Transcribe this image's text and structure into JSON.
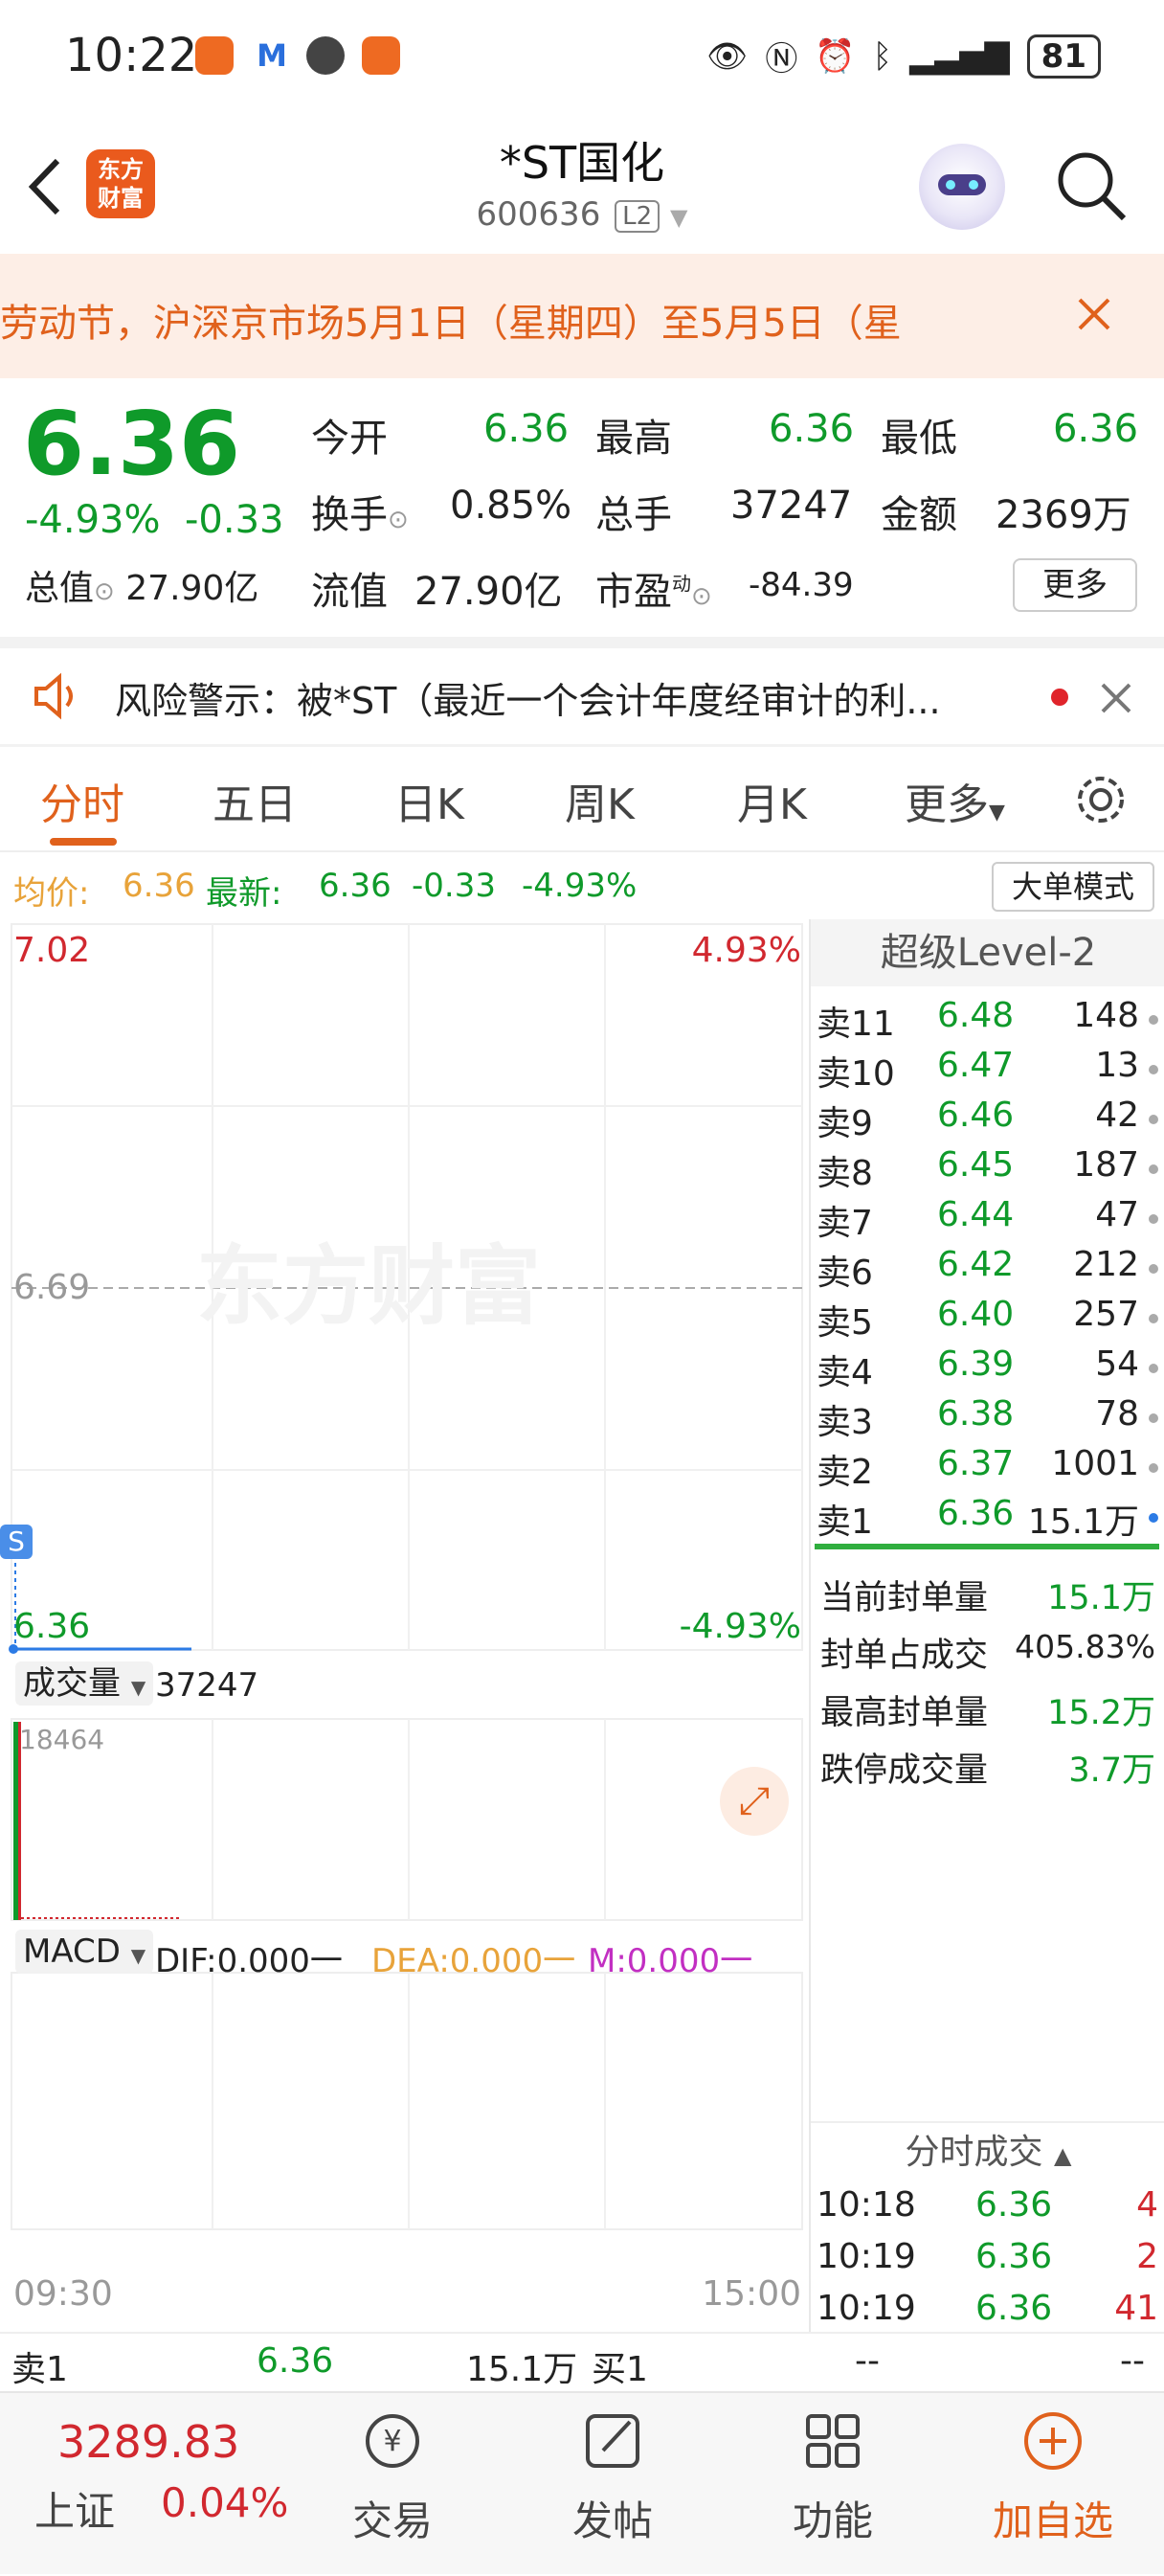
{
  "status_bar": {
    "time": "10:22",
    "battery": "81"
  },
  "header": {
    "title": "*ST国化",
    "code": "600636",
    "level_badge": "L2",
    "logo_text_1": "东方",
    "logo_text_2": "财富"
  },
  "banner": {
    "text": "劳动节，沪深京市场5月1日（星期四）至5月5日（星"
  },
  "quote": {
    "price": "6.36",
    "change_pct": "-4.93%",
    "change": "-0.33",
    "open_label": "今开",
    "open": "6.36",
    "high_label": "最高",
    "high": "6.36",
    "low_label": "最低",
    "low": "6.36",
    "turnover_label": "换手",
    "turnover": "0.85%",
    "volume_label": "总手",
    "volume": "37247",
    "amount_label": "金额",
    "amount": "2369万",
    "mktcap_label": "总值",
    "mktcap": "27.90亿",
    "float_label": "流值",
    "float": "27.90亿",
    "pe_label": "市盈",
    "pe_sup": "动",
    "pe": "-84.39",
    "more_label": "更多"
  },
  "risk": {
    "text": "风险警示：被*ST（最近一个会计年度经审计的利..."
  },
  "tabs": [
    "分时",
    "五日",
    "日K",
    "周K",
    "月K",
    "更多"
  ],
  "avg_line": {
    "avg_label": "均价:",
    "avg": "6.36",
    "latest_label": "最新:",
    "latest": "6.36",
    "change": "-0.33",
    "pct": "-4.93%",
    "big_order": "大单模式"
  },
  "chart": {
    "y_max": "7.02",
    "y_max_pct": "4.93%",
    "y_mid": "6.69",
    "y_min": "6.36",
    "y_min_pct": "-4.93%",
    "s_marker": "S",
    "watermark": "东方财富",
    "volume_label": "成交量",
    "volume_total": "37247",
    "volume_max": "18464",
    "macd_label": "MACD",
    "dif": "DIF:0.000一",
    "dea": "DEA:0.000一",
    "m": "M:0.000一",
    "time_start": "09:30",
    "time_end": "15:00"
  },
  "level2": {
    "title": "超级Level-2",
    "asks": [
      {
        "label": "卖11",
        "price": "6.48",
        "vol": "148"
      },
      {
        "label": "卖10",
        "price": "6.47",
        "vol": "13"
      },
      {
        "label": "卖9",
        "price": "6.46",
        "vol": "42"
      },
      {
        "label": "卖8",
        "price": "6.45",
        "vol": "187"
      },
      {
        "label": "卖7",
        "price": "6.44",
        "vol": "47"
      },
      {
        "label": "卖6",
        "price": "6.42",
        "vol": "212"
      },
      {
        "label": "卖5",
        "price": "6.40",
        "vol": "257"
      },
      {
        "label": "卖4",
        "price": "6.39",
        "vol": "54"
      },
      {
        "label": "卖3",
        "price": "6.38",
        "vol": "78"
      },
      {
        "label": "卖2",
        "price": "6.37",
        "vol": "1001"
      },
      {
        "label": "卖1",
        "price": "6.36",
        "vol": "15.1万"
      }
    ],
    "stats": [
      {
        "label": "当前封单量",
        "value": "15.1万"
      },
      {
        "label": "封单占成交",
        "value": "405.83%"
      },
      {
        "label": "最高封单量",
        "value": "15.2万"
      },
      {
        "label": "跌停成交量",
        "value": "3.7万"
      }
    ],
    "ticks_title": "分时成交",
    "ticks": [
      {
        "time": "10:18",
        "price": "6.36",
        "vol": "4"
      },
      {
        "time": "10:19",
        "price": "6.36",
        "vol": "2"
      },
      {
        "time": "10:19",
        "price": "6.36",
        "vol": "41"
      }
    ]
  },
  "strip": {
    "sell_label": "卖1",
    "sell_price": "6.36",
    "sell_vol": "15.1万",
    "buy_label": "买1",
    "buy_price": "--",
    "buy_vol": "--"
  },
  "bottom_nav": {
    "index_value": "3289.83",
    "index_name": "上证",
    "index_pct": "0.04%",
    "trade": "交易",
    "post": "发帖",
    "func": "功能",
    "add": "加自选"
  }
}
